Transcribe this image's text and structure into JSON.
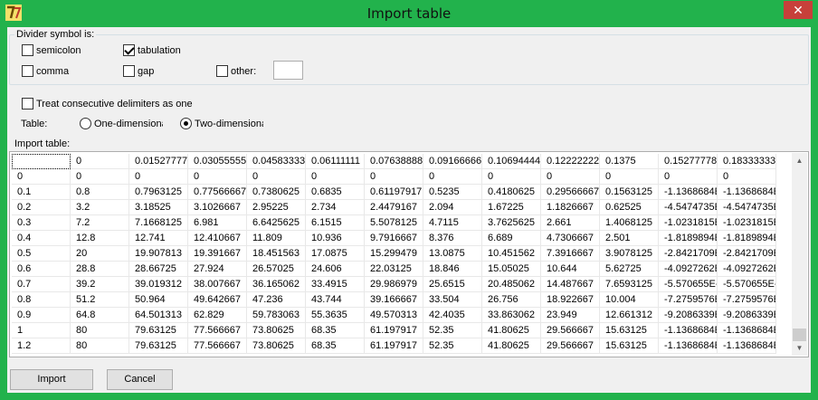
{
  "window": {
    "title": "Import table",
    "close_glyph": "✕"
  },
  "divider": {
    "group_label": "Divider symbol is:",
    "semicolon": {
      "label": "semicolon",
      "checked": false
    },
    "tabulation": {
      "label": "tabulation",
      "checked": true
    },
    "comma": {
      "label": "comma",
      "checked": false
    },
    "gap": {
      "label": "gap",
      "checked": false
    },
    "other": {
      "label": "other:",
      "checked": false,
      "value": ""
    }
  },
  "consecutive": {
    "label": "Treat consecutive delimiters as one",
    "checked": false
  },
  "table_type": {
    "label": "Table:",
    "one_dim": {
      "label": "One-dimensional",
      "selected": false
    },
    "two_dim": {
      "label": "Two-dimensional",
      "selected": true
    }
  },
  "import_table_label": "Import table:",
  "grid": {
    "rows": [
      [
        "",
        "0",
        "0.01527777",
        "0.03055555",
        "0.04583333",
        "0.06111111",
        "0.07638888",
        "0.09166666",
        "0.10694444",
        "0.12222222",
        "0.1375",
        "0.15277778",
        "0.18333333"
      ],
      [
        "0",
        "0",
        "0",
        "0",
        "0",
        "0",
        "0",
        "0",
        "0",
        "0",
        "0",
        "0",
        "0"
      ],
      [
        "0.1",
        "0.8",
        "0.7963125",
        "0.77566667",
        "0.7380625",
        "0.6835",
        "0.61197917",
        "0.5235",
        "0.4180625",
        "0.29566667",
        "0.1563125",
        "-1.1368684E",
        "-1.1368684E"
      ],
      [
        "0.2",
        "3.2",
        "3.18525",
        "3.1026667",
        "2.95225",
        "2.734",
        "2.4479167",
        "2.094",
        "1.67225",
        "1.1826667",
        "0.62525",
        "-4.5474735E",
        "-4.5474735E"
      ],
      [
        "0.3",
        "7.2",
        "7.1668125",
        "6.981",
        "6.6425625",
        "6.1515",
        "5.5078125",
        "4.7115",
        "3.7625625",
        "2.661",
        "1.4068125",
        "-1.0231815E",
        "-1.0231815E"
      ],
      [
        "0.4",
        "12.8",
        "12.741",
        "12.410667",
        "11.809",
        "10.936",
        "9.7916667",
        "8.376",
        "6.689",
        "4.7306667",
        "2.501",
        "-1.8189894E",
        "-1.8189894E"
      ],
      [
        "0.5",
        "20",
        "19.907813",
        "19.391667",
        "18.451563",
        "17.0875",
        "15.299479",
        "13.0875",
        "10.451562",
        "7.3916667",
        "3.9078125",
        "-2.8421709E",
        "-2.8421709E"
      ],
      [
        "0.6",
        "28.8",
        "28.66725",
        "27.924",
        "26.57025",
        "24.606",
        "22.03125",
        "18.846",
        "15.05025",
        "10.644",
        "5.62725",
        "-4.0927262E",
        "-4.0927262E"
      ],
      [
        "0.7",
        "39.2",
        "39.019312",
        "38.007667",
        "36.165062",
        "33.4915",
        "29.986979",
        "25.6515",
        "20.485062",
        "14.487667",
        "7.6593125",
        "-5.570655E-",
        "-5.570655E-"
      ],
      [
        "0.8",
        "51.2",
        "50.964",
        "49.642667",
        "47.236",
        "43.744",
        "39.166667",
        "33.504",
        "26.756",
        "18.922667",
        "10.004",
        "-7.2759576E",
        "-7.2759576E"
      ],
      [
        "0.9",
        "64.8",
        "64.501313",
        "62.829",
        "59.783063",
        "55.3635",
        "49.570313",
        "42.4035",
        "33.863062",
        "23.949",
        "12.661312",
        "-9.2086339E",
        "-9.2086339E"
      ],
      [
        "1",
        "80",
        "79.63125",
        "77.566667",
        "73.80625",
        "68.35",
        "61.197917",
        "52.35",
        "41.80625",
        "29.566667",
        "15.63125",
        "-1.1368684E",
        "-1.1368684E"
      ],
      [
        "1.2",
        "80",
        "79.63125",
        "77.566667",
        "73.80625",
        "68.35",
        "61.197917",
        "52.35",
        "41.80625",
        "29.566667",
        "15.63125",
        "-1.1368684E",
        "-1.1368684E"
      ]
    ]
  },
  "buttons": {
    "import": "Import",
    "cancel": "Cancel"
  }
}
